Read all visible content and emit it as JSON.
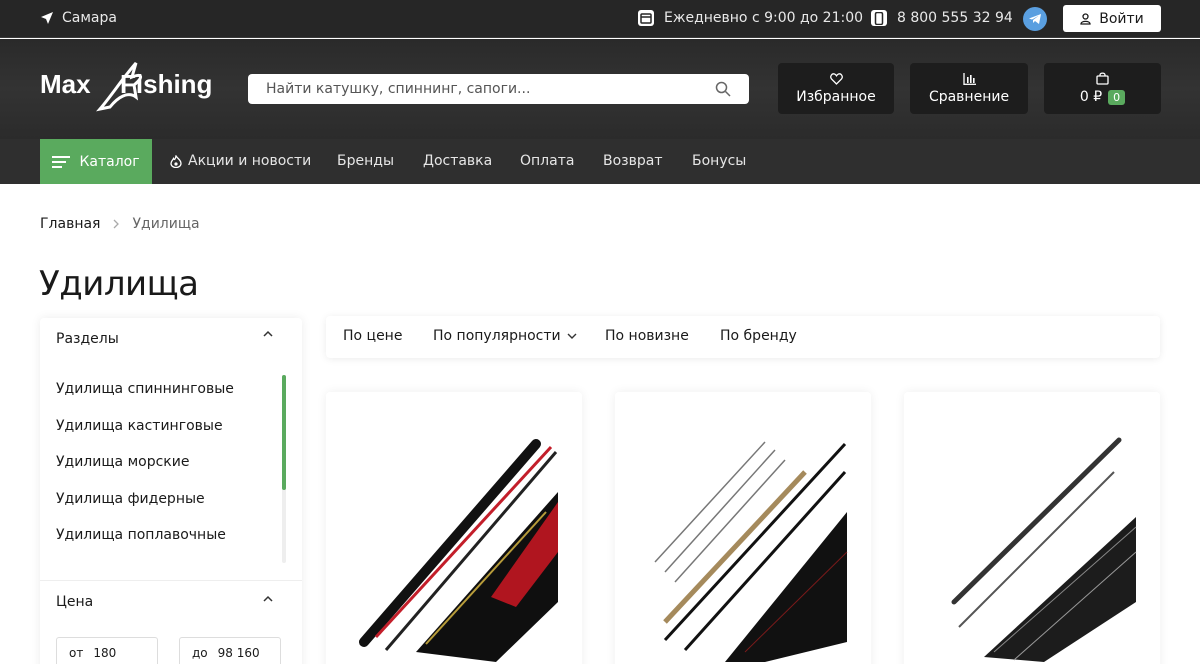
{
  "topbar": {
    "city": "Самара",
    "hours": "Ежедневно с 9:00 до 21:00",
    "phone": "8 800 555 32 94",
    "login": "Войти"
  },
  "header": {
    "logo_left": "Max",
    "logo_right": "Fishing",
    "search_placeholder": "Найти катушку, спиннинг, сапоги...",
    "favorites": "Избранное",
    "compare": "Сравнение",
    "cart_total": "0 ₽",
    "cart_count": "0"
  },
  "nav": {
    "catalog": "Каталог",
    "items": [
      "Акции и новости",
      "Бренды",
      "Доставка",
      "Оплата",
      "Возврат",
      "Бонусы"
    ]
  },
  "breadcrumb": [
    "Главная",
    "Удилища"
  ],
  "page_title": "Удилища",
  "sidebar": {
    "sections_title": "Разделы",
    "sections": [
      "Удилища спиннинговые",
      "Удилища кастинговые",
      "Удилища морские",
      "Удилища фидерные",
      "Удилища поплавочные"
    ],
    "price_title": "Цена",
    "price_from_label": "от",
    "price_from": "180",
    "price_to_label": "до",
    "price_to": "98 160"
  },
  "sort": [
    "По цене",
    "По популярности",
    "По новизне",
    "По бренду"
  ],
  "products": [
    {
      "image": "spinning-rod-red-black"
    },
    {
      "image": "feeder-rod-set"
    },
    {
      "image": "spinning-rod-grey"
    }
  ],
  "colors": {
    "accent": "#5aaa5e",
    "dark": "#262626",
    "telegram": "#5a9fe0"
  }
}
